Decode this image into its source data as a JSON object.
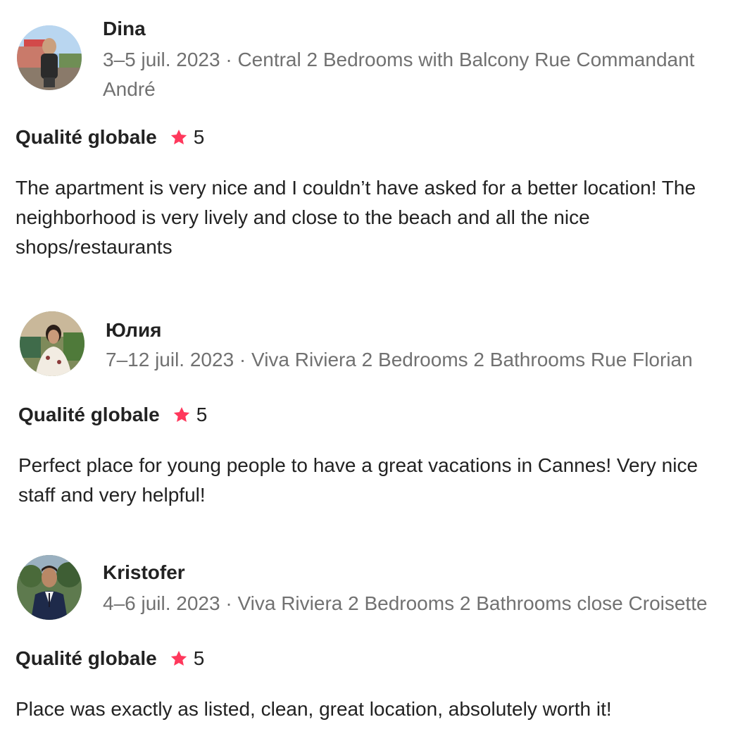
{
  "reviews": [
    {
      "name": "Dina",
      "meta": "3–5 juil. 2023 · Central 2 Bedrooms with Balcony Rue Commandant André",
      "rating_label": "Qualité globale",
      "rating_value": "5",
      "text": "The apartment is very nice and I couldn’t have asked for a better location! The neighborhood is very lively and close to the beach and all the nice shops/restaurants"
    },
    {
      "name": "Юлия",
      "meta": "7–12 juil. 2023 · Viva Riviera 2 Bedrooms 2 Bathrooms Rue Florian",
      "rating_label": "Qualité globale",
      "rating_value": "5",
      "text": "Perfect place for young people to have a great vacations in Cannes! Very nice staff and very helpful!"
    },
    {
      "name": "Kristofer",
      "meta": "4–6 juil. 2023 · Viva Riviera 2 Bedrooms 2 Bathrooms close Croisette",
      "rating_label": "Qualité globale",
      "rating_value": "5",
      "text": "Place was exactly as listed, clean, great location, absolutely worth it!"
    }
  ],
  "icons": {
    "star": "star-icon"
  },
  "colors": {
    "star": "#FF385C",
    "primary_text": "#222222",
    "secondary_text": "#717171"
  }
}
